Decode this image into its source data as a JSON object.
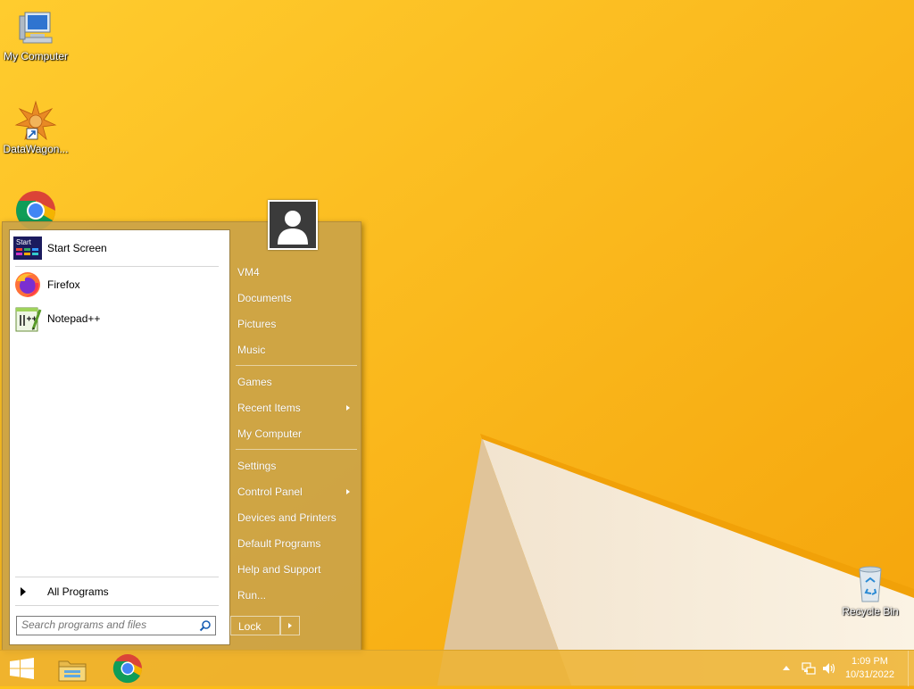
{
  "desktop": {
    "icons": [
      {
        "label": "My Computer"
      },
      {
        "label": "DataWagon..."
      },
      {
        "label": "Google Chrome"
      },
      {
        "label": "Recycle Bin"
      }
    ]
  },
  "start_menu": {
    "pinned": [
      {
        "label": "Start Screen",
        "icon": "start-screen-icon",
        "icon_text": "Start"
      },
      {
        "label": "Firefox",
        "icon": "firefox-icon"
      },
      {
        "label": "Notepad++",
        "icon": "notepad-plus-plus-icon"
      }
    ],
    "all_programs_label": "All Programs",
    "search_placeholder": "Search programs and files",
    "right_items": [
      {
        "label": "VM4"
      },
      {
        "label": "Documents"
      },
      {
        "label": "Pictures"
      },
      {
        "label": "Music"
      },
      {
        "label": "Games"
      },
      {
        "label": "Recent Items",
        "has_submenu": true
      },
      {
        "label": "My Computer"
      },
      {
        "label": "Settings"
      },
      {
        "label": "Control Panel",
        "has_submenu": true
      },
      {
        "label": "Devices and Printers"
      },
      {
        "label": "Default Programs"
      },
      {
        "label": "Help and Support"
      },
      {
        "label": "Run..."
      }
    ],
    "lock_label": "Lock"
  },
  "taskbar": {
    "pinned": [
      {
        "icon": "windows-start-icon"
      },
      {
        "icon": "file-explorer-icon"
      },
      {
        "icon": "chrome-icon"
      }
    ],
    "clock": {
      "time": "1:09 PM",
      "date": "10/31/2022"
    }
  },
  "colors": {
    "wallpaper": "#f8ad0c",
    "start_menu": "#cba348",
    "taskbar": "#edb230"
  }
}
